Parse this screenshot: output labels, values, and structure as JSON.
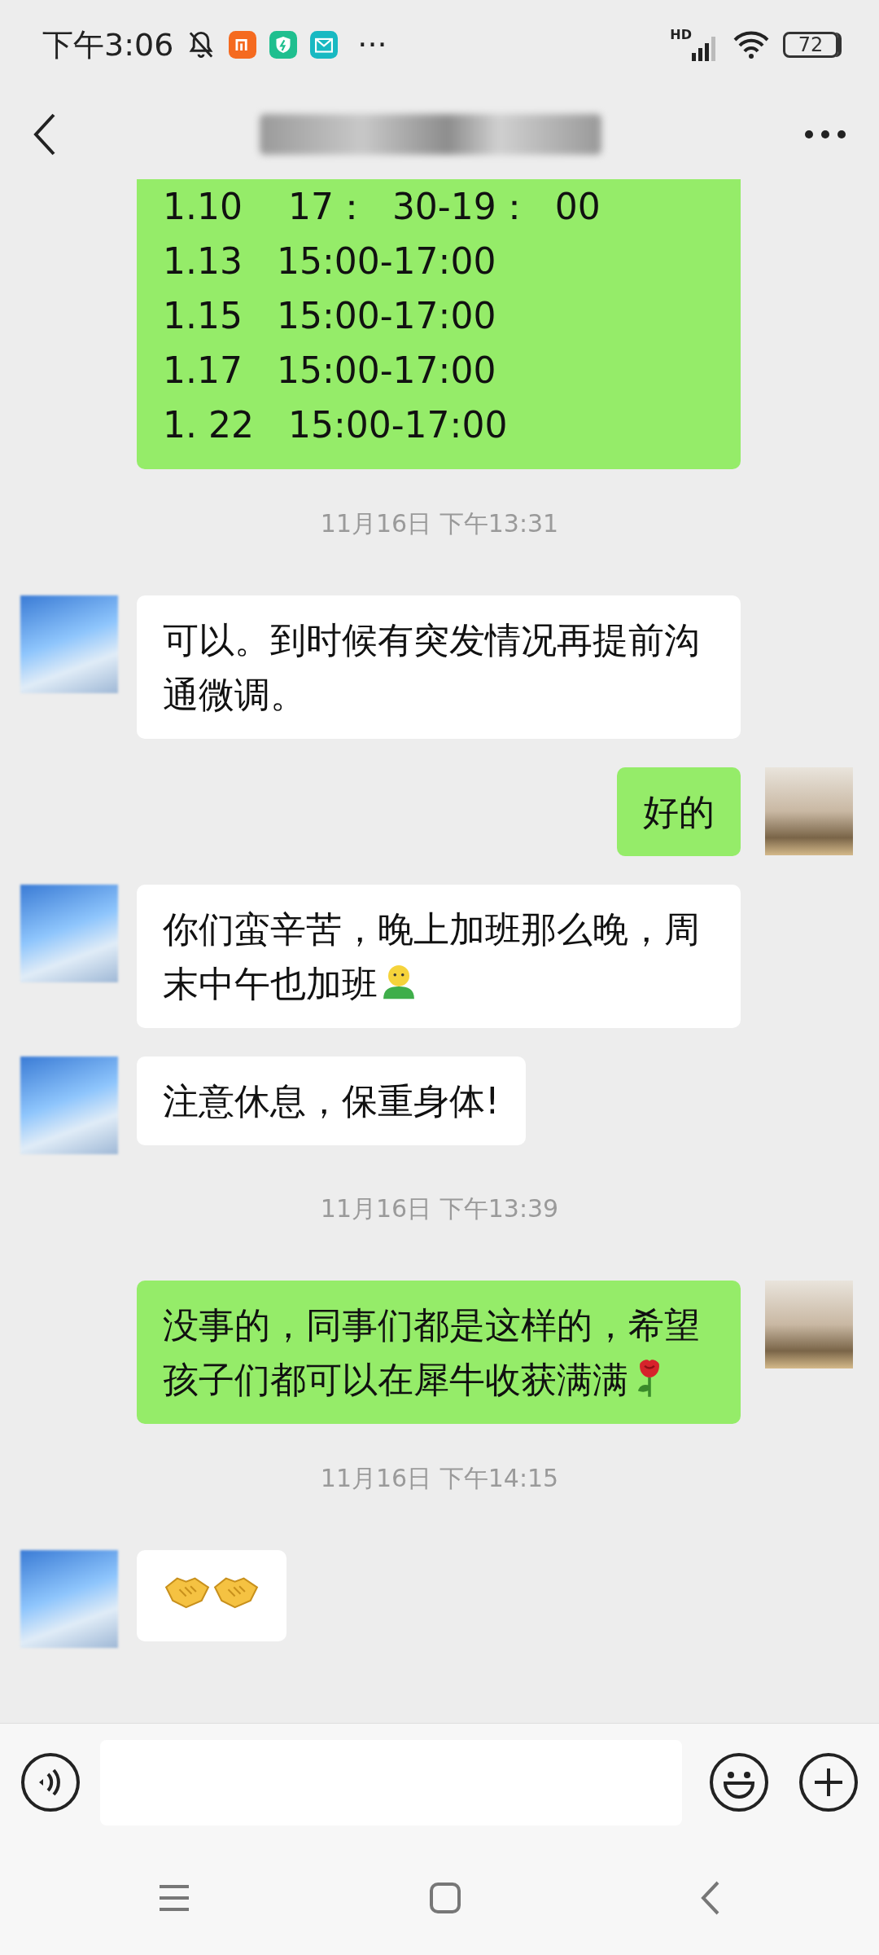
{
  "status_bar": {
    "time": "下午3:06",
    "more": "···",
    "network": "HD",
    "battery": "72"
  },
  "header": {
    "title_blurred": true
  },
  "messages": [
    {
      "kind": "bubble",
      "from_me": true,
      "cut_top": true,
      "lines": [
        "1.10    17：  30-19：  00",
        "1.13   15:00-17:00",
        "1.15   15:00-17:00",
        "1.17   15:00-17:00",
        "1. 22   15:00-17:00"
      ]
    },
    {
      "kind": "time",
      "text": "11月16日 下午13:31"
    },
    {
      "kind": "bubble",
      "from_me": false,
      "lines": [
        "可以。到时候有突发情况再提前沟通微调。"
      ]
    },
    {
      "kind": "bubble",
      "from_me": true,
      "lines": [
        "好的"
      ]
    },
    {
      "kind": "bubble",
      "from_me": false,
      "lines": [
        "你们蛮辛苦，晚上加班那么晚，周末中午也加班"
      ],
      "icons": [
        {
          "kind": "person"
        }
      ]
    },
    {
      "kind": "bubble",
      "from_me": false,
      "lines": [
        "注意休息，保重身体!"
      ]
    },
    {
      "kind": "time",
      "text": "11月16日 下午13:39"
    },
    {
      "kind": "bubble",
      "from_me": true,
      "lines": [
        "没事的，同事们都是这样的，希望孩子们都可以在犀牛收获满满"
      ],
      "icons": [
        {
          "kind": "rose"
        }
      ]
    },
    {
      "kind": "time",
      "text": "11月16日 下午14:15"
    },
    {
      "kind": "bubble",
      "from_me": false,
      "icons": [
        {
          "kind": "handshake"
        },
        {
          "kind": "handshake"
        }
      ]
    }
  ]
}
